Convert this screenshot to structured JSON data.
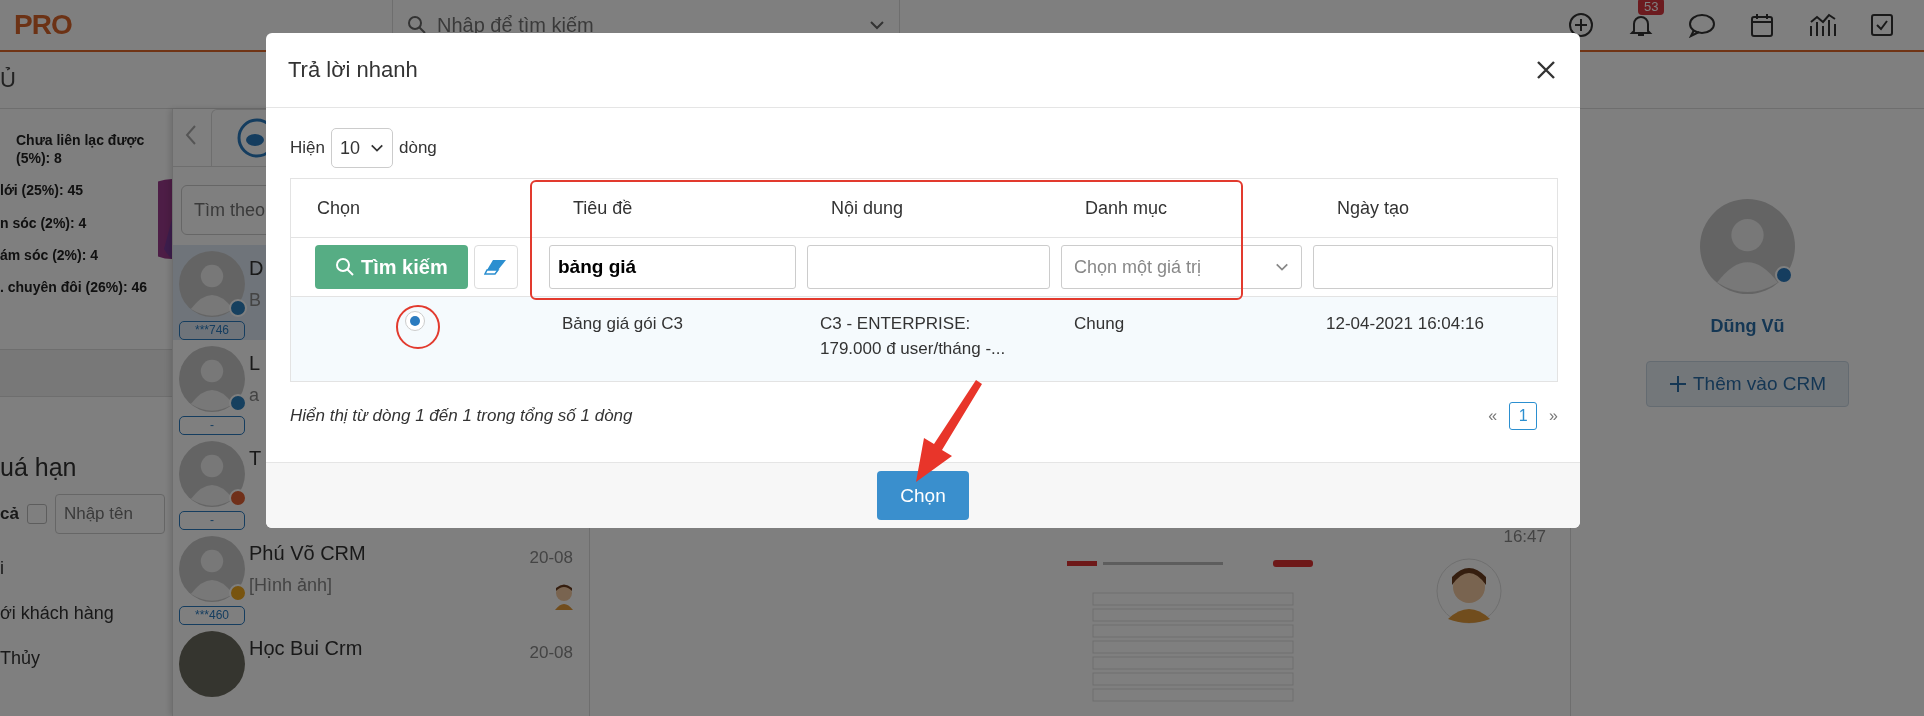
{
  "topbar": {
    "logo": "PRO",
    "search": {
      "placeholder": "Nhập để tìm kiếm"
    },
    "notification_count": "53"
  },
  "page_title": "Ủ",
  "chart_labels": [
    [
      "Chưa liên lạc được",
      "(5%): 8"
    ],
    [
      "lới (25%): 45"
    ],
    [
      "n sóc (2%): 4"
    ],
    [
      "ám sóc (2%): 4"
    ],
    [
      ". chuyên đôi (26%): 46"
    ]
  ],
  "overdue": {
    "title": "uá hạn",
    "select_all": {
      "label": "cả",
      "checked": false
    },
    "name_filter": {
      "placeholder": "Nhập tên"
    },
    "lines": [
      "i",
      "ới khách hàng",
      "Thủy"
    ]
  },
  "chat_list": {
    "search": {
      "placeholder": "Tìm theo"
    },
    "conversations": [
      {
        "kind": "default",
        "name": "D",
        "preview": "B",
        "tag": "***746",
        "color": "#16405f",
        "sticker": false,
        "selected": true
      },
      {
        "kind": "default",
        "name": "L",
        "preview": "a",
        "tag": "-",
        "color": "#16405f",
        "sticker": false,
        "selected": false
      },
      {
        "kind": "default",
        "name": "T",
        "tag": "-",
        "color": "#70301a",
        "selected": false
      },
      {
        "kind": "default",
        "name": "Phú Võ CRM",
        "date": "20-08",
        "preview": "[Hình ảnh]",
        "tag": "***460",
        "color": "#78540f",
        "sticker": true,
        "selected": false
      },
      {
        "kind": "photo",
        "name": "Học Bui Crm",
        "date": "20-08"
      }
    ]
  },
  "chat": {
    "time": "16:47"
  },
  "contact": {
    "name": "Dũng Vũ",
    "add_button": "Thêm vào CRM"
  },
  "modal": {
    "title": "Trả lời nhanh",
    "show_label": "Hiện",
    "page_size": "10",
    "rows_label": "dòng",
    "columns": [
      "Chọn",
      "Tiêu đề",
      "Nội dung",
      "Danh mục",
      "Ngày tạo"
    ],
    "search_button": "Tìm kiếm",
    "filters": [
      {
        "kind": "text",
        "value": "bảng giá"
      },
      {
        "kind": "text"
      },
      {
        "kind": "select",
        "placeholder": "Chọn một giá trị"
      },
      {
        "kind": "text"
      }
    ],
    "rows": [
      {
        "selected": true,
        "title": "Bảng giá gói C3",
        "content_lines": [
          "C3 - ENTERPRISE:",
          "179.000 đ user/tháng -..."
        ],
        "category": "Chung",
        "created": "12-04-2021 16:04:16"
      }
    ],
    "summary": "Hiển thị từ dòng 1 đến 1 trong tổng số 1 dòng",
    "pagination": {
      "prev": "«",
      "pages": [
        {
          "label": "1",
          "selected": true
        }
      ],
      "next": "»"
    },
    "choose_button": "Chọn"
  }
}
